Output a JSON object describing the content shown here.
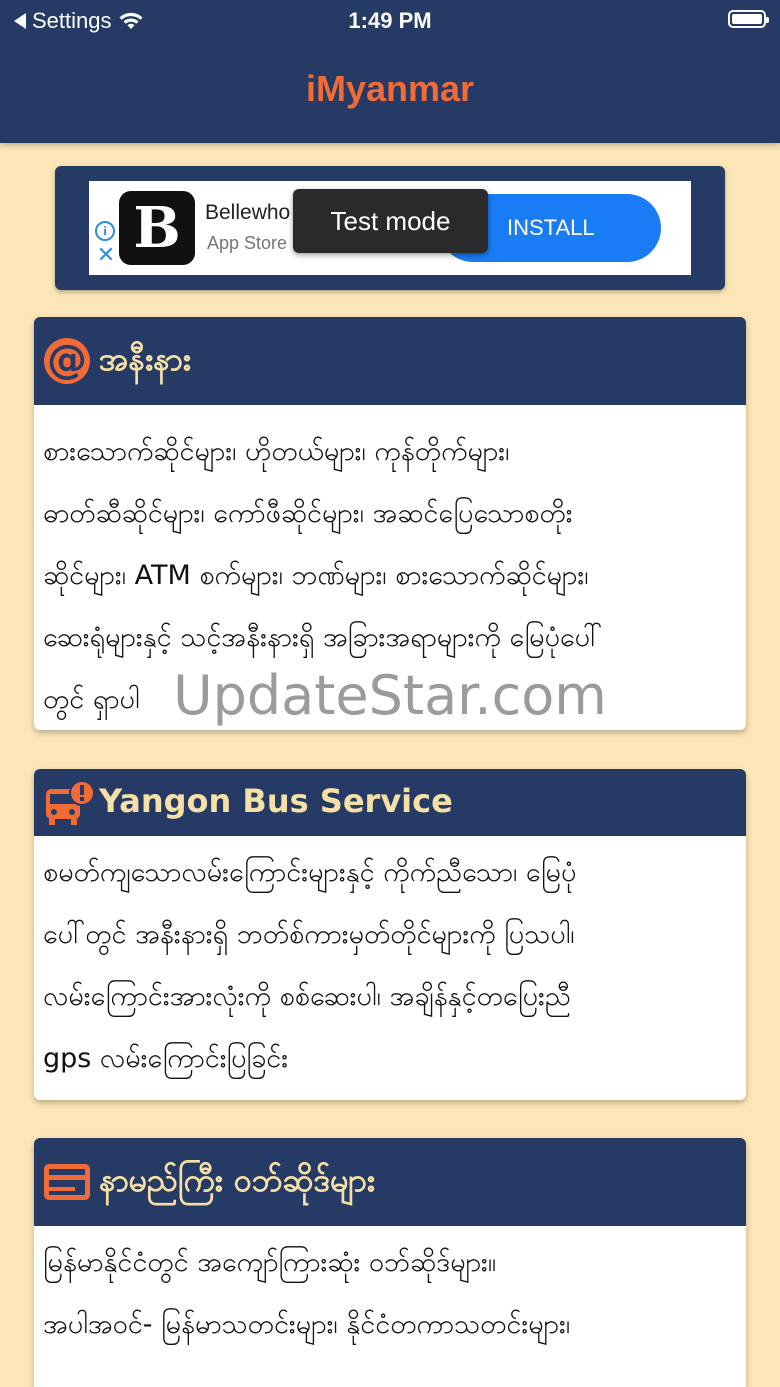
{
  "status_bar": {
    "back_label": "Settings",
    "time": "1:49 PM"
  },
  "header": {
    "title": "iMyanmar"
  },
  "ad": {
    "brand": "Bellewho",
    "store": "App Store",
    "install_label": "INSTALL",
    "test_mode_label": "Test mode",
    "logo_letter": "B"
  },
  "cards": [
    {
      "title": "အနီးနား",
      "icon": "at-sign-icon",
      "lines": [
        "စားသောက်ဆိုင်များ၊ ဟိုတယ်များ၊ ကုန်တိုက်များ၊",
        "ဓာတ်ဆီဆိုင်များ၊ ကော်ဖီဆိုင်များ၊ အဆင်ပြေသောစတိုး",
        "ဆိုင်များ၊ ATM စက်များ၊ ဘဏ်များ၊ စားသောက်ဆိုင်များ၊",
        "ဆေးရုံများနှင့် သင့်အနီးနားရှိ အခြားအရာများကို မြေပုံပေါ်",
        "တွင် ရှာပါ"
      ]
    },
    {
      "title": "Yangon Bus Service",
      "icon": "bus-icon",
      "lines": [
        "စမတ်ကျသောလမ်းကြောင်းများနှင့် ကိုက်ညီသော၊ မြေပုံ",
        "ပေါ်တွင် အနီးနားရှိ ဘတ်စ်ကားမှတ်တိုင်များကို ပြသပါ၊",
        "လမ်းကြောင်းအားလုံးကို စစ်ဆေးပါ၊ အချိန်နှင့်တပြေးညီ",
        "gps လမ်းကြောင်းပြခြင်း"
      ]
    },
    {
      "title": "နာမည်ကြီး ဝဘ်ဆိုဒ်များ",
      "icon": "website-icon",
      "lines": [
        "မြန်မာနိုင်ငံတွင် အကျော်ကြားဆုံး ဝဘ်ဆိုဒ်များ။",
        "အပါအဝင်- မြန်မာသတင်းများ၊ နိုင်ငံတကာသတင်းများ၊"
      ]
    }
  ],
  "watermark": "UpdateStar.com",
  "colors": {
    "header_bg": "#253a64",
    "accent": "#f26a36",
    "page_bg": "#fce6b8",
    "card_title": "#f7e0a5"
  }
}
